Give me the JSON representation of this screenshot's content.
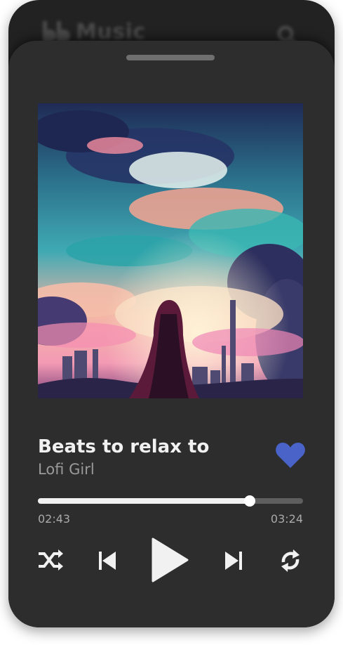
{
  "header": {
    "app_title": "Music",
    "logo_icon": "bb-logo-icon",
    "search_icon": "search-icon"
  },
  "player": {
    "artwork_description": "album-artwork",
    "track_title": "Beats to relax to",
    "artist": "Lofi Girl",
    "liked": true,
    "time_elapsed": "02:43",
    "time_total": "03:24",
    "progress_fraction": 0.8,
    "controls": [
      "shuffle-icon",
      "skip-previous-icon",
      "play-icon",
      "skip-next-icon",
      "repeat-icon"
    ]
  },
  "colors": {
    "background": "#222222",
    "sheet": "#2d2d2d",
    "accent_heart": "#4a63c9",
    "text_primary": "#f1f1f1",
    "text_secondary": "#9a9a9a"
  }
}
